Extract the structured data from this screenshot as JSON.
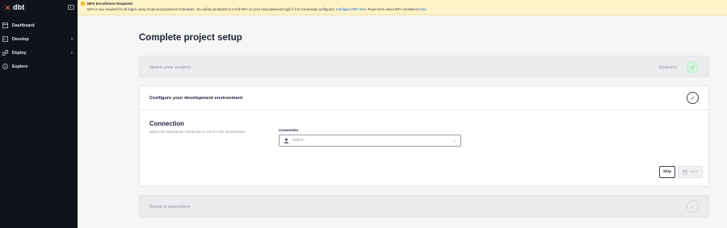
{
  "sidebar": {
    "brand": "dbt",
    "items": [
      {
        "label": "Dashboard",
        "icon": "dashboard-icon",
        "has_submenu": false
      },
      {
        "label": "Develop",
        "icon": "develop-icon",
        "has_submenu": true
      },
      {
        "label": "Deploy",
        "icon": "deploy-icon",
        "has_submenu": true
      },
      {
        "label": "Explore",
        "icon": "explore-icon",
        "has_submenu": false
      }
    ]
  },
  "banner": {
    "title": "MFA Enrollment Required",
    "message_prefix": "MFA is now required for all logins using email and password credentials. You will be prompted to enroll MFA on your next password login if it is not already configured.",
    "configure_link": "Configure MFA here.",
    "read_more_prefix": "Read more about MFA enrollment",
    "read_more_link": "here."
  },
  "page": {
    "title": "Complete project setup"
  },
  "steps": {
    "name_project": {
      "title": "Name your project",
      "summary": "Analytics",
      "state": "done"
    },
    "dev_env": {
      "title": "Configure your development environment",
      "state": "open",
      "connection_heading": "Connection",
      "connection_desc": "Select the warehouse connection to use for this environment.",
      "field_label": "Connection",
      "select_placeholder": "Select...",
      "skip_label": "Skip",
      "save_label": "Save"
    },
    "repository": {
      "title": "Setup a repository",
      "state": "pending"
    }
  },
  "colors": {
    "sidebar_bg": "#10131c",
    "banner_bg": "#fdf3c9",
    "accent_link": "#1c68c9",
    "done_check": "#3fbf62",
    "logo_orange": "#ff694a"
  }
}
